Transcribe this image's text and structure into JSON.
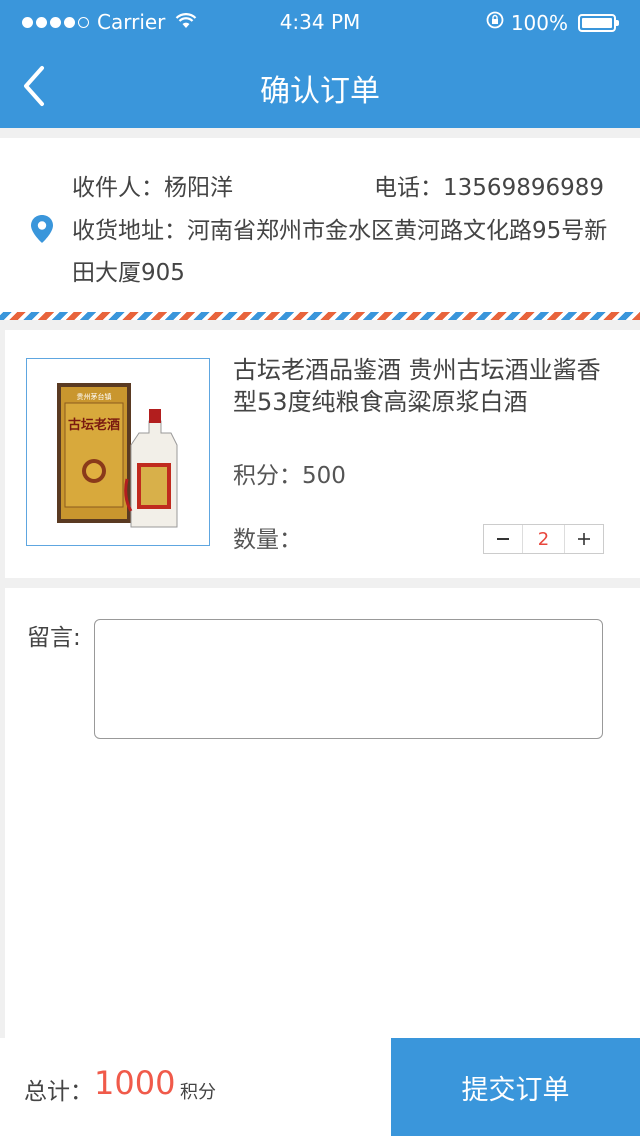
{
  "status_bar": {
    "carrier": "Carrier",
    "time": "4:34 PM",
    "battery": "100%"
  },
  "nav": {
    "title": "确认订单"
  },
  "address": {
    "recipient": "收件人：杨阳洋",
    "phone": "电话：13569896989",
    "address": "收货地址：河南省郑州市金水区黄河路文化路95号新田大厦905"
  },
  "product": {
    "name": "古坛老酒品鉴酒 贵州古坛酒业酱香型53度纯粮食高粱原浆白酒",
    "points": "积分：500",
    "qty_label": "数量：",
    "quantity": "2",
    "image_label_brand": "贵州茅台镇",
    "image_label_name": "古坛老酒"
  },
  "message": {
    "label": "留言:",
    "value": ""
  },
  "footer": {
    "total_label": "总计：",
    "total_value": "1000",
    "total_unit": "积分",
    "submit_label": "提交订单"
  },
  "colors": {
    "primary": "#3a96db",
    "accent_red": "#f05a4a"
  }
}
